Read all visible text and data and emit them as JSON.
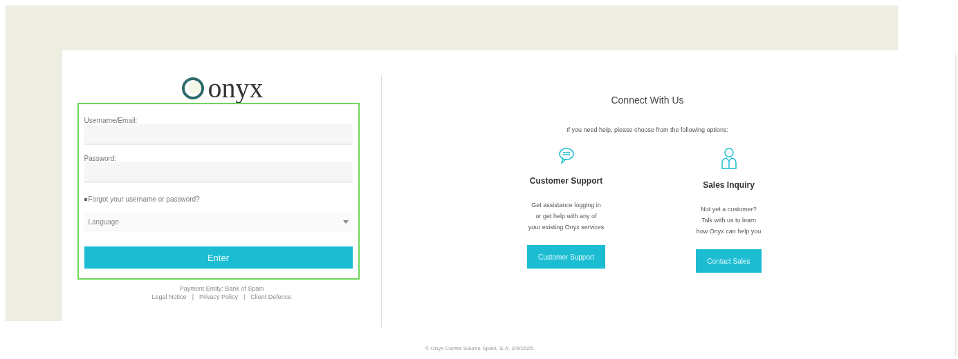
{
  "logo": {
    "text": "onyx"
  },
  "login": {
    "fields": [
      {
        "label": "Username/Email:"
      },
      {
        "label": "Password:"
      }
    ],
    "forgot_link": "Forgot your username or password?",
    "language": {
      "placeholder": "Language"
    },
    "submit": "Enter",
    "payment_entity": "Payment Entity: Bank of Spain",
    "links": [
      "Legal Notice",
      "Privacy Policy",
      "Client Defence"
    ],
    "separator": "|"
  },
  "connect": {
    "title": "Connect With Us",
    "subtitle": "If you need help, please choose from the following options:",
    "options": [
      {
        "kind": "support",
        "title": "Customer Support",
        "lines": [
          "Get assistance logging in",
          "or get help with any of",
          "your existing Onyx services"
        ],
        "button": "Customer Support"
      },
      {
        "kind": "sales",
        "title": "Sales Inquiry",
        "lines": [
          "Not yet a customer?",
          "Talk with us to learn",
          "how Onyx can help you"
        ],
        "button": "Contact Sales"
      }
    ]
  },
  "footer": "© Onyx Centre Source Spain, S.A. 2/9/2025"
}
